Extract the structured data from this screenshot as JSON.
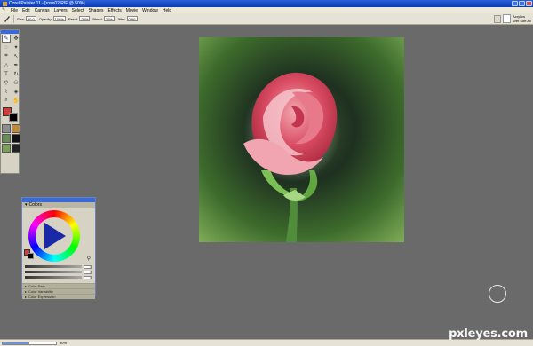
{
  "window": {
    "title": "Corel Painter 11 - [rose02.RIF @ 50%]"
  },
  "menubar": {
    "items": [
      "File",
      "Edit",
      "Canvas",
      "Layers",
      "Select",
      "Shapes",
      "Effects",
      "Movie",
      "Window",
      "Help"
    ]
  },
  "property_bar": {
    "size_label": "Size:",
    "size_value": "50.0",
    "opacity_label": "Opacity:",
    "opacity_value": "100%",
    "resat_label": "Resat:",
    "resat_value": "20%",
    "bleed_label": "Bleed:",
    "bleed_value": "70%",
    "jitter_label": "Jitter:",
    "jitter_value": "0.00",
    "brush_category": "Acrylics",
    "brush_variant": "Wet Soft Ac"
  },
  "toolbox": {
    "tools": [
      "brush",
      "layer-adjuster",
      "lasso",
      "magic-wand",
      "crop",
      "transform",
      "shape",
      "pen",
      "text",
      "rotate-page",
      "cloner",
      "rubber-stamp",
      "dropper",
      "paint-bucket",
      "zoom",
      "grabber"
    ],
    "main_color": "#d23c3c",
    "additional_color": "#000000"
  },
  "colors_palette": {
    "title": "Colors",
    "sliders": [
      {
        "label": "H",
        "value": "0"
      },
      {
        "label": "S",
        "value": "0"
      },
      {
        "label": "V",
        "value": "0"
      }
    ],
    "sections": [
      "Color Sets",
      "Color Variability",
      "Color Expression"
    ]
  },
  "statusbar": {
    "zoom": "50%"
  },
  "watermark": "pxleyes.com"
}
